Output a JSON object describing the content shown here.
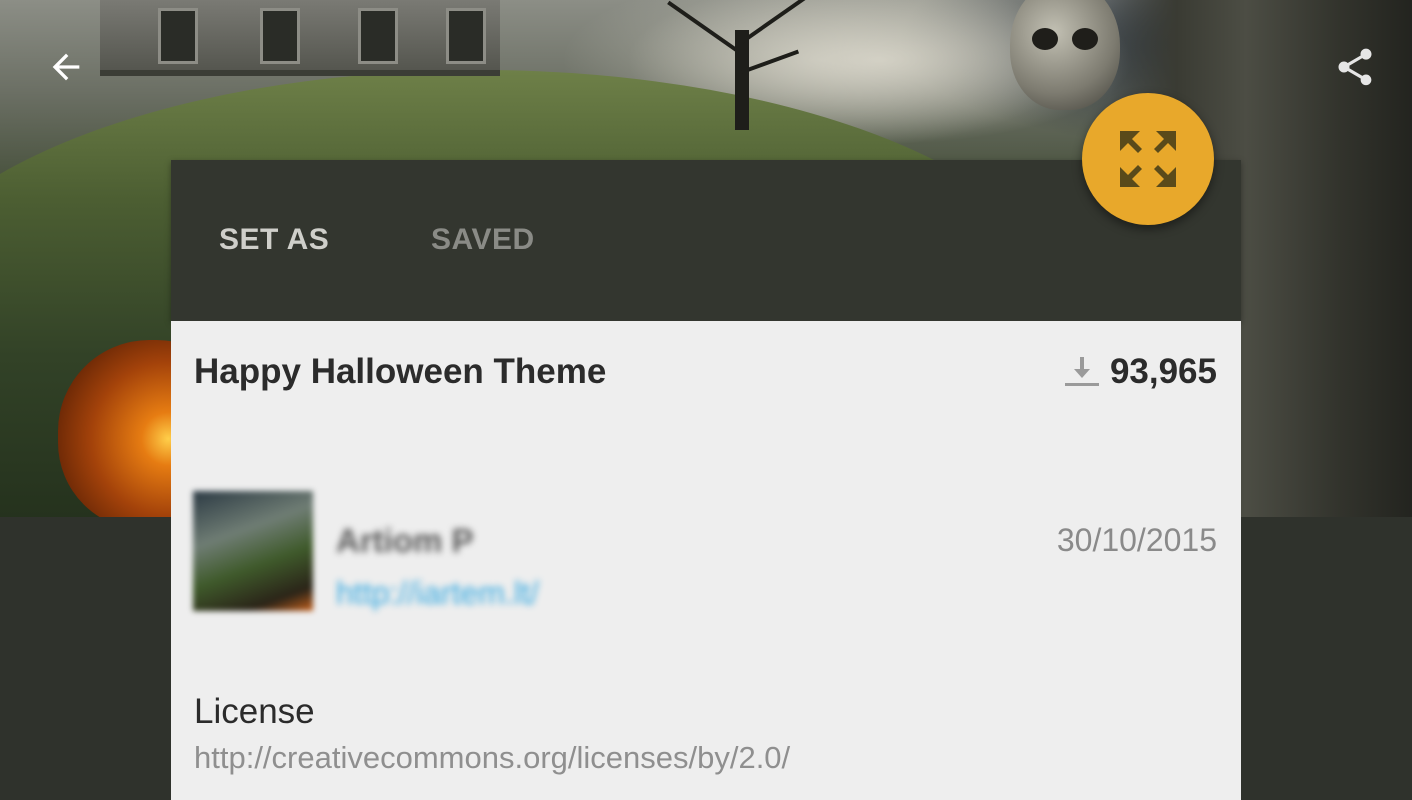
{
  "header": {
    "back_icon": "arrow-back-icon",
    "share_icon": "share-icon"
  },
  "tabs": [
    {
      "label": "SET AS"
    },
    {
      "label": "SAVED"
    }
  ],
  "fab": {
    "icon": "fullscreen-expand-icon",
    "color": "#e8a82b"
  },
  "theme": {
    "title": "Happy Halloween Theme",
    "download_icon": "download-icon",
    "downloads": "93,965"
  },
  "author": {
    "name": "Artiom P",
    "link": "http://iartem.lt/",
    "date": "30/10/2015"
  },
  "license": {
    "heading": "License",
    "url": "http://creativecommons.org/licenses/by/2.0/"
  },
  "colors": {
    "panel_dark": "#33362f",
    "card_light": "#eeeeee",
    "accent": "#e8a82b",
    "link": "#36a9e1"
  }
}
